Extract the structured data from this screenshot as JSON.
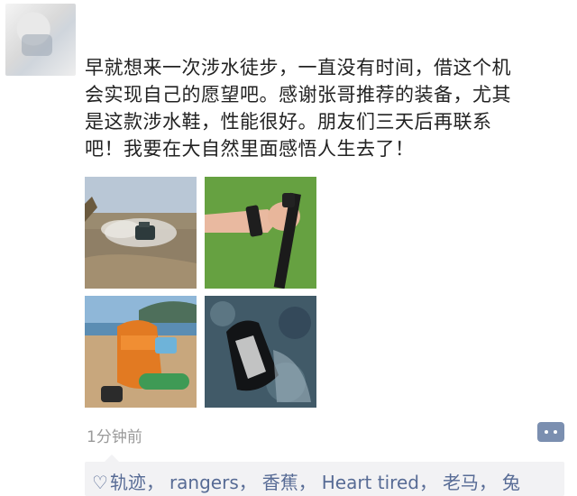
{
  "post": {
    "text_lines": [
      "早就想来一次涉水徒步，一直没有时间，借这个机",
      "会实现自己的愿望吧。感谢张哥推荐的装备，尤其",
      "是这款涉水鞋，性能很好。朋友们三天后再联系",
      "吧！我要在大自然里面感悟人生去了！"
    ],
    "time": "1分钟前"
  },
  "likes": {
    "icon": "heart-outline-icon",
    "names": [
      "轨迹",
      "rangers",
      "香蕉",
      "Heart tired",
      "老马",
      "兔"
    ],
    "separator": "，"
  },
  "colors": {
    "link": "#576b95",
    "time": "#9a9a9a",
    "likes_bg": "#f2f2f4"
  }
}
